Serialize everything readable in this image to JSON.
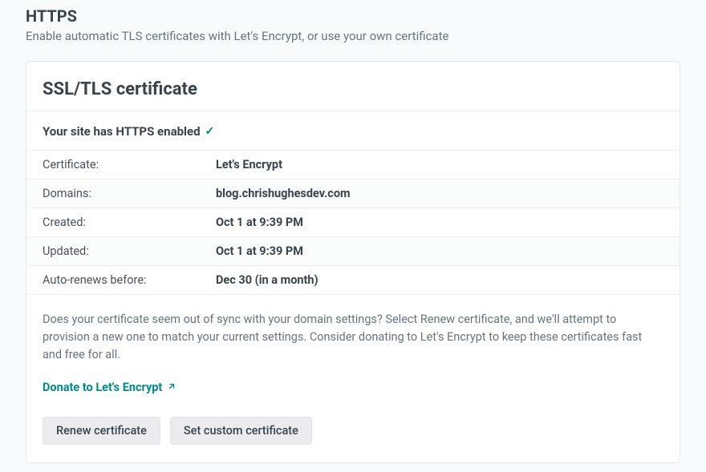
{
  "header": {
    "title": "HTTPS",
    "subtitle": "Enable automatic TLS certificates with Let's Encrypt, or use your own certificate"
  },
  "card": {
    "title": "SSL/TLS certificate",
    "status_text": "Your site has HTTPS enabled",
    "details": [
      {
        "label": "Certificate:",
        "value": "Let's Encrypt"
      },
      {
        "label": "Domains:",
        "value": "blog.chrishughesdev.com"
      },
      {
        "label": "Created:",
        "value": "Oct 1 at 9:39 PM"
      },
      {
        "label": "Updated:",
        "value": "Oct 1 at 9:39 PM"
      },
      {
        "label": "Auto-renews before:",
        "value": "Dec 30 (in a month)"
      }
    ],
    "description": "Does your certificate seem out of sync with your domain settings? Select Renew certificate, and we'll attempt to provision a new one to match your current settings. Consider donating to Let's Encrypt to keep these certificates fast and free for all.",
    "donate_link": "Donate to Let's Encrypt",
    "buttons": {
      "renew": "Renew certificate",
      "custom": "Set custom certificate"
    }
  }
}
